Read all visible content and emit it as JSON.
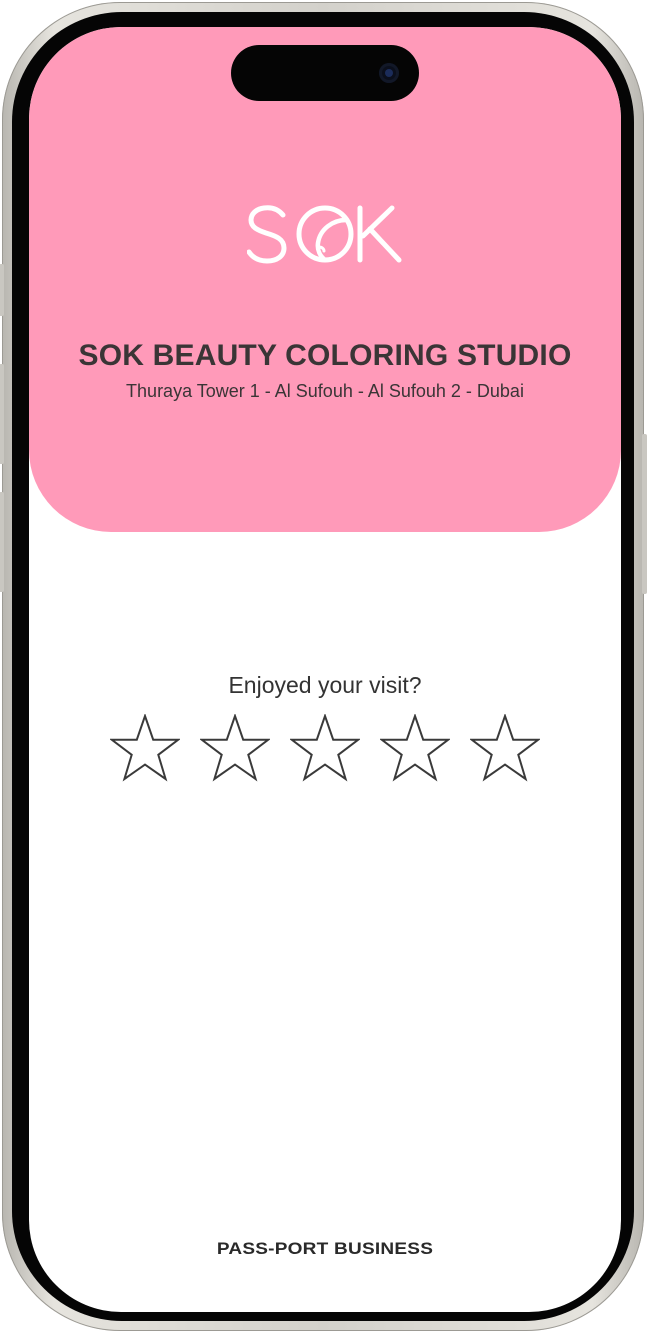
{
  "header": {
    "logo_text": "SOK",
    "studio_name": "SOK BEAUTY COLORING STUDIO",
    "address": "Thuraya Tower 1 - Al Sufouh - Al Sufouh 2 - Dubai",
    "background_color": "#ff9ab9"
  },
  "rating": {
    "prompt": "Enjoyed your visit?",
    "max_stars": 5,
    "selected_stars": 0,
    "stars": [
      {
        "icon": "star-outline-icon"
      },
      {
        "icon": "star-outline-icon"
      },
      {
        "icon": "star-outline-icon"
      },
      {
        "icon": "star-outline-icon"
      },
      {
        "icon": "star-outline-icon"
      }
    ]
  },
  "footer": {
    "brand": "PASS-PORT BUSINESS"
  }
}
